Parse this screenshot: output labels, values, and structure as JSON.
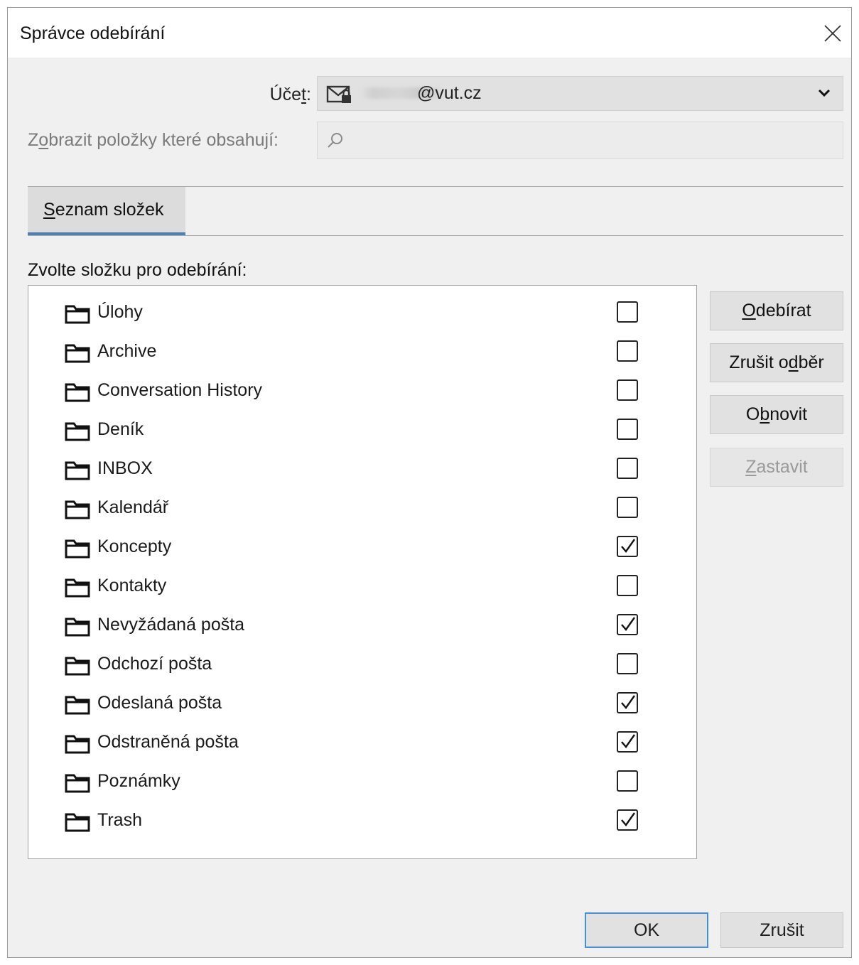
{
  "window": {
    "title": "Správce odebírání"
  },
  "account": {
    "label_pre": "Úče",
    "label_key": "t",
    "label_post": ":",
    "value": "@vut.cz"
  },
  "filter": {
    "label_pre": "Z",
    "label_key": "o",
    "label_post": "brazit položky které obsahují:",
    "value": "",
    "placeholder": ""
  },
  "tabs": [
    {
      "pre": "",
      "key": "S",
      "post": "eznam složek",
      "selected": true
    }
  ],
  "list_label": "Zvolte složku pro odebírání:",
  "folders": [
    {
      "name": "Úlohy",
      "subscribed": false
    },
    {
      "name": "Archive",
      "subscribed": false
    },
    {
      "name": "Conversation History",
      "subscribed": false
    },
    {
      "name": "Deník",
      "subscribed": false
    },
    {
      "name": "INBOX",
      "subscribed": false
    },
    {
      "name": "Kalendář",
      "subscribed": false
    },
    {
      "name": "Koncepty",
      "subscribed": true
    },
    {
      "name": "Kontakty",
      "subscribed": false
    },
    {
      "name": "Nevyžádaná pošta",
      "subscribed": true
    },
    {
      "name": "Odchozí pošta",
      "subscribed": false
    },
    {
      "name": "Odeslaná pošta",
      "subscribed": true
    },
    {
      "name": "Odstraněná pošta",
      "subscribed": true
    },
    {
      "name": "Poznámky",
      "subscribed": false
    },
    {
      "name": "Trash",
      "subscribed": true
    }
  ],
  "side_buttons": {
    "subscribe": {
      "pre": "",
      "key": "O",
      "post": "debírat",
      "enabled": true
    },
    "unsubscribe": {
      "pre": "Zrušit o",
      "key": "d",
      "post": "běr",
      "enabled": true
    },
    "refresh": {
      "pre": "O",
      "key": "b",
      "post": "novit",
      "enabled": true
    },
    "stop": {
      "pre": "",
      "key": "Z",
      "post": "astavit",
      "enabled": false
    }
  },
  "footer": {
    "ok": "OK",
    "cancel": "Zrušit"
  },
  "colors": {
    "accent": "#4f7fb7",
    "focus": "#4a8fd6",
    "dialog_bg": "#f0f0f0"
  },
  "icons": {
    "close": "close-icon",
    "mail_lock": "mail-lock-icon",
    "chevron": "chevron-down-icon",
    "search": "search-icon",
    "folder": "folder-icon",
    "check": "checkmark-icon"
  }
}
